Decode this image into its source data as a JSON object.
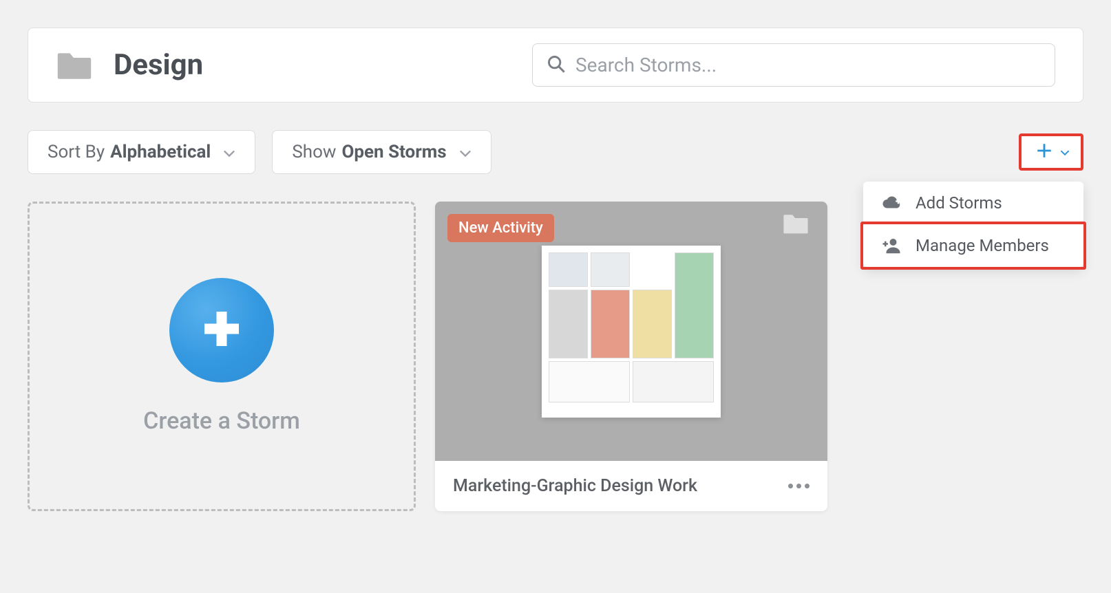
{
  "header": {
    "title": "Design",
    "search_placeholder": "Search Storms..."
  },
  "filters": {
    "sort": {
      "label": "Sort By",
      "value": "Alphabetical"
    },
    "show": {
      "label": "Show",
      "value": "Open Storms"
    }
  },
  "add_menu": {
    "items": [
      {
        "label": "Add Storms",
        "icon": "cloud-plus"
      },
      {
        "label": "Manage Members",
        "icon": "person-plus"
      }
    ],
    "highlighted_index": 1
  },
  "create_card": {
    "label": "Create a Storm"
  },
  "storms": [
    {
      "title": "Marketing-Graphic Design Work",
      "badge": "New Activity"
    }
  ]
}
